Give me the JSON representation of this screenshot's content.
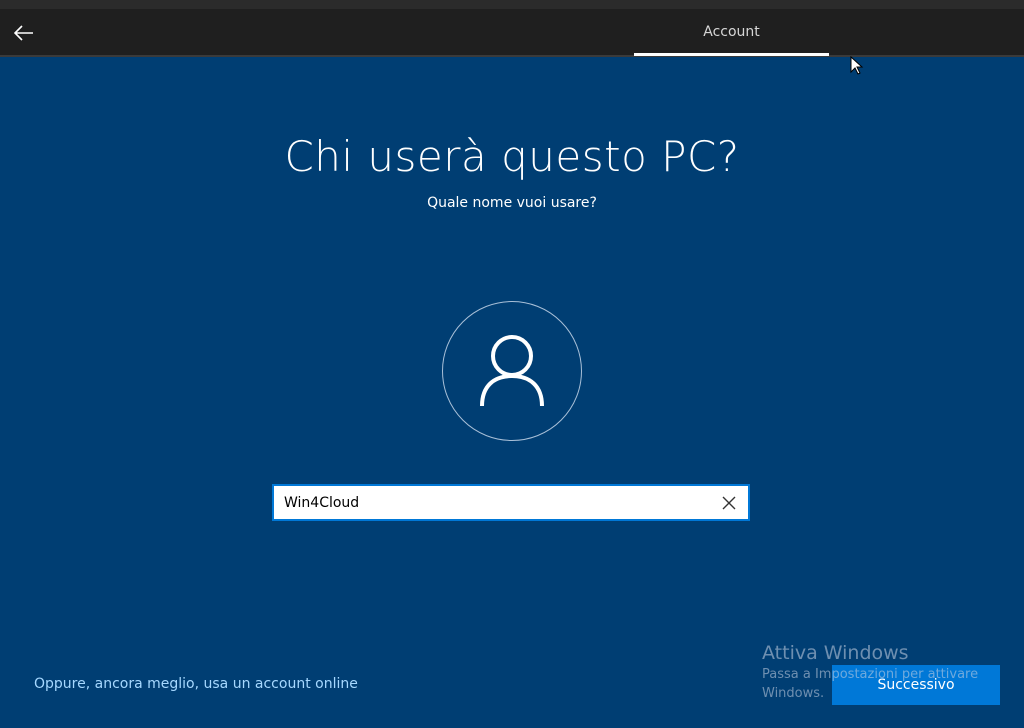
{
  "header": {
    "tab_label": "Account"
  },
  "main": {
    "title": "Chi userà questo PC?",
    "subtitle": "Quale nome vuoi usare?",
    "name_input": {
      "value": "Win4Cloud",
      "placeholder": ""
    }
  },
  "footer": {
    "online_account_link": "Oppure, ancora meglio, usa un account online",
    "next_button": "Successivo"
  },
  "watermark": {
    "title": "Attiva Windows",
    "subtitle": "Passa a Impostazioni per attivare Windows."
  },
  "icons": {
    "back": "arrow-left-icon",
    "avatar": "user-icon",
    "clear": "close-icon",
    "pointer": "mouse-cursor-icon"
  },
  "colors": {
    "background": "#003e73",
    "titlebar": "#1f1f1f",
    "accent": "#0078d7",
    "link": "#a6d8ff"
  }
}
